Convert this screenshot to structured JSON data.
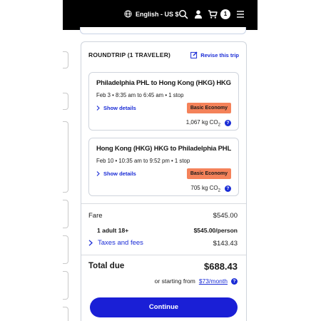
{
  "header": {
    "language_label": "English - US $",
    "cart_count": "1"
  },
  "trip": {
    "title": "ROUNDTRIP (1 TRAVELER)",
    "revise_label": "Revise this trip"
  },
  "flights": [
    {
      "route": "Philadelphia PHL to Hong Kong (HKG) HKG",
      "times": "Feb 3 • 8:35 am to 6:45 am • 1 stop",
      "details_label": "Show details",
      "fare_class": "Basic Economy",
      "co2": "1,067 kg CO",
      "co2_sub": "2"
    },
    {
      "route": "Hong Kong (HKG) HKG to Philadelphia PHL",
      "times": "Feb 10 • 10:35 am to 9:52 pm • 1 stop",
      "details_label": "Show details",
      "fare_class": "Basic Economy",
      "co2": "705 kg CO",
      "co2_sub": "2"
    }
  ],
  "pricing": {
    "fare_label": "Fare",
    "fare_value": "$545.00",
    "traveler_label": "1 adult 18+",
    "traveler_value": "$545.00/person",
    "taxes_label": "Taxes and fees",
    "taxes_value": "$143.43",
    "total_label": "Total due",
    "total_value": "$688.43",
    "starting_prefix": "or starting from",
    "monthly_value": "$73/month",
    "help_glyph": "?"
  },
  "actions": {
    "continue_label": "Continue"
  },
  "colors": {
    "header_bg": "#000000",
    "accent_blue": "#1a2cd6",
    "badge_orange": "#f4825a"
  }
}
